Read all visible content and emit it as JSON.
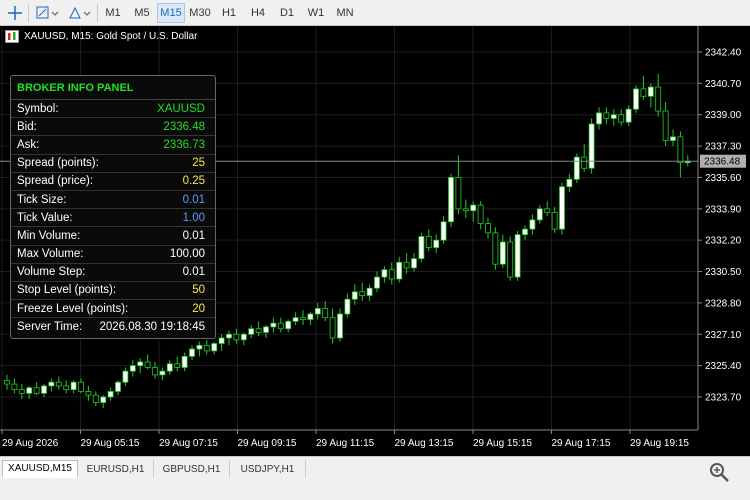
{
  "toolbar": {
    "timeframes": [
      "M1",
      "M5",
      "M15",
      "M30",
      "H1",
      "H4",
      "D1",
      "W1",
      "MN"
    ],
    "active_timeframe": "M15"
  },
  "chart": {
    "title": "XAUUSD, M15:  Gold Spot / U.S. Dollar",
    "price_labels": [
      "2342.40",
      "2340.70",
      "2339.00",
      "2337.30",
      "2335.60",
      "2333.90",
      "2332.20",
      "2330.50",
      "2328.80",
      "2327.10",
      "2325.40",
      "2323.70"
    ],
    "current_price": "2336.48",
    "time_labels": [
      "29 Aug 2026",
      "29 Aug 05:15",
      "29 Aug 07:15",
      "29 Aug 09:15",
      "29 Aug 11:15",
      "29 Aug 13:15",
      "29 Aug 15:15",
      "29 Aug 17:15",
      "29 Aug 19:15"
    ],
    "colors": {
      "background": "#000000",
      "bull_candle": "#ffffff",
      "bear_candle": "#000000",
      "wick": "#22cc22",
      "grid": "#1e1e1e",
      "bid_line": "#888888"
    }
  },
  "panel": {
    "title": "BROKER INFO PANEL",
    "rows": [
      {
        "label": "Symbol:",
        "value": "XAUUSD",
        "color": "green"
      },
      {
        "label": "Bid:",
        "value": "2336.48",
        "color": "green"
      },
      {
        "label": "Ask:",
        "value": "2336.73",
        "color": "green"
      },
      {
        "label": "Spread (points):",
        "value": "25",
        "color": "yellow"
      },
      {
        "label": "Spread (price):",
        "value": "0.25",
        "color": "yellow"
      },
      {
        "label": "Tick Size:",
        "value": "0.01",
        "color": "blue"
      },
      {
        "label": "Tick Value:",
        "value": "1.00",
        "color": "blue"
      },
      {
        "label": "Min Volume:",
        "value": "0.01",
        "color": "white"
      },
      {
        "label": "Max Volume:",
        "value": "100.00",
        "color": "white"
      },
      {
        "label": "Volume Step:",
        "value": "0.01",
        "color": "white"
      },
      {
        "label": "Stop Level (points):",
        "value": "50",
        "color": "yellow"
      },
      {
        "label": "Freeze Level (points):",
        "value": "20",
        "color": "yellow"
      },
      {
        "label": "Server Time:",
        "value": "2026.08.30 19:18:45",
        "color": "white"
      }
    ]
  },
  "tabs": [
    {
      "label": "XAUUSD,M15",
      "active": true
    },
    {
      "label": "EURUSD,H1",
      "active": false
    },
    {
      "label": "GBPUSD,H1",
      "active": false
    },
    {
      "label": "USDJPY,H1",
      "active": false
    }
  ]
}
